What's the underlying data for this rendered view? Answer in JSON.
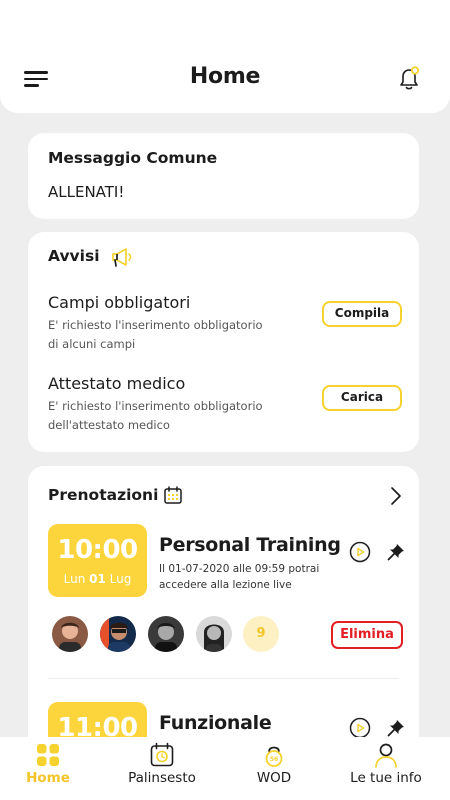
{
  "header": {
    "title": "Home"
  },
  "message": {
    "title": "Messaggio Comune",
    "body": "ALLENATI!"
  },
  "notices": {
    "title": "Avvisi",
    "items": [
      {
        "title": "Campi obbligatori",
        "description": "E' richiesto l'inserimento obbligatorio di alcuni campi",
        "action": "Compila"
      },
      {
        "title": "Attestato medico",
        "description": "E' richiesto l'inserimento obbligatorio dell'attestato medico",
        "action": "Carica"
      }
    ]
  },
  "bookings": {
    "title": "Prenotazioni",
    "items": [
      {
        "time": "10:00",
        "day": "Lun",
        "date_num": "01",
        "month": "Lug",
        "title": "Personal Training",
        "subtitle": "Il 01-07-2020 alle 09:59 potrai accedere alla lezione live",
        "extra_count": "9",
        "delete_label": "Elimina"
      },
      {
        "time": "11:00",
        "title": "Funzionale"
      }
    ]
  },
  "nav": {
    "items": [
      {
        "label": "Home",
        "icon": "grid-icon",
        "active": true
      },
      {
        "label": "Palinsesto",
        "icon": "calendar-clock-icon"
      },
      {
        "label": "WOD",
        "icon": "kettlebell-icon"
      },
      {
        "label": "Le tue info",
        "icon": "user-icon"
      }
    ]
  },
  "colors": {
    "accent": "#fcd43b",
    "danger": "#e31e24",
    "background": "#eeeeee"
  }
}
